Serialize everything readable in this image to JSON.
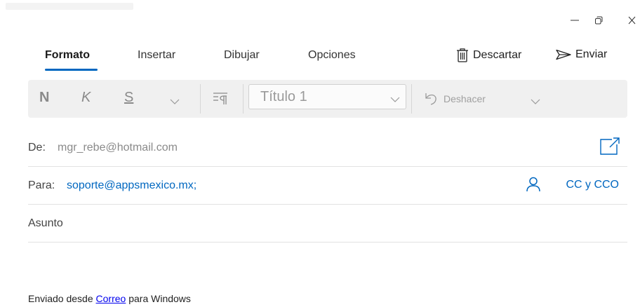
{
  "window": {
    "controls": [
      "minimize-icon",
      "restore-icon",
      "close-icon"
    ]
  },
  "tabs": [
    {
      "label": "Formato",
      "active": true
    },
    {
      "label": "Insertar",
      "active": false
    },
    {
      "label": "Dibujar",
      "active": false
    },
    {
      "label": "Opciones",
      "active": false
    }
  ],
  "commands": {
    "discard_label": "Descartar",
    "send_label": "Enviar"
  },
  "toolbar": {
    "bold": "N",
    "italic": "K",
    "underline": "S",
    "style_value": "Título 1",
    "undo_label": "Deshacer"
  },
  "compose": {
    "from_label": "De:",
    "from_value": "mgr_rebe@hotmail.com",
    "to_label": "Para:",
    "to_value": "soporte@appsmexico.mx;",
    "cc_label": "CC y CCO",
    "subject_placeholder": "Asunto"
  },
  "body": {
    "prefix": "Enviado desde ",
    "link": "Correo",
    "suffix": " para Windows"
  },
  "colors": {
    "accent": "#0067c0",
    "toolbar_bg": "#f0f0f0"
  }
}
